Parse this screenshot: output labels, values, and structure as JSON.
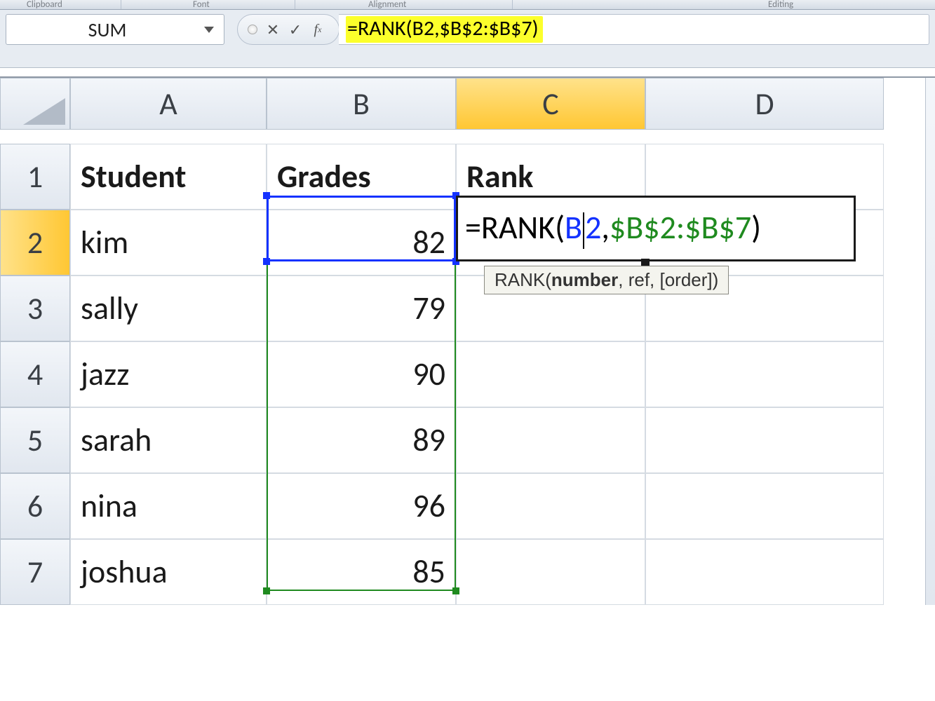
{
  "ribbon": {
    "groups": [
      "Clipboard",
      "Font",
      "Alignment",
      "Editing"
    ]
  },
  "name_box": "SUM",
  "formula_bar": "=RANK(B2,$B$2:$B$7)",
  "columns": [
    "A",
    "B",
    "C",
    "D"
  ],
  "row_numbers": [
    "1",
    "2",
    "3",
    "4",
    "5",
    "6",
    "7"
  ],
  "headers": {
    "A": "Student",
    "B": "Grades",
    "C": "Rank"
  },
  "rows": [
    {
      "student": "kim",
      "grade": "82"
    },
    {
      "student": "sally",
      "grade": "79"
    },
    {
      "student": "jazz",
      "grade": "90"
    },
    {
      "student": "sarah",
      "grade": "89"
    },
    {
      "student": "nina",
      "grade": "96"
    },
    {
      "student": "joshua",
      "grade": "85"
    }
  ],
  "editing": {
    "prefix": "=RANK(",
    "arg1_a": "B",
    "arg1_b": "2",
    "sep": ",",
    "arg2": "$B$2:$B$7",
    "suffix": ")"
  },
  "tooltip": {
    "fn": "RANK(",
    "bold": "number",
    "rest": ", ref, [order])"
  },
  "chart_data": {
    "type": "table",
    "columns": [
      "Student",
      "Grades"
    ],
    "rows": [
      [
        "kim",
        82
      ],
      [
        "sally",
        79
      ],
      [
        "jazz",
        90
      ],
      [
        "sarah",
        89
      ],
      [
        "nina",
        96
      ],
      [
        "joshua",
        85
      ]
    ],
    "formula_cell": "C2",
    "formula": "=RANK(B2,$B$2:$B$7)"
  }
}
